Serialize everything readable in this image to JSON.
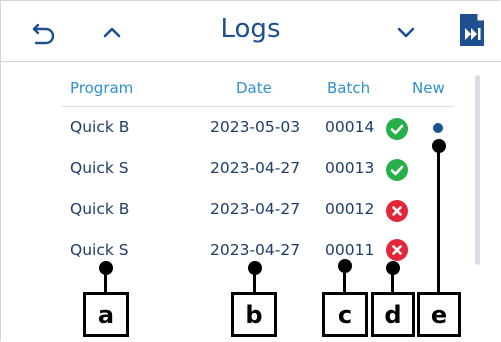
{
  "header": {
    "title": "Logs"
  },
  "columns": {
    "program": "Program",
    "date": "Date",
    "batch": "Batch",
    "new": "New"
  },
  "rows": [
    {
      "program": "Quick B",
      "date": "2023-05-03",
      "batch": "00014",
      "status": "success",
      "new": true
    },
    {
      "program": "Quick S",
      "date": "2023-04-27",
      "batch": "00013",
      "status": "success",
      "new": false
    },
    {
      "program": "Quick B",
      "date": "2023-04-27",
      "batch": "00012",
      "status": "failure",
      "new": false
    },
    {
      "program": "Quick S",
      "date": "2023-04-27",
      "batch": "00011",
      "status": "failure",
      "new": false
    }
  ],
  "callouts": [
    "a",
    "b",
    "c",
    "d",
    "e"
  ],
  "icons": {
    "back": "back-arrow-icon",
    "up": "chevron-up-icon",
    "down": "chevron-down-icon",
    "export": "export-icon",
    "success": "check-circle-icon",
    "failure": "x-circle-icon",
    "new": "new-dot-icon"
  },
  "colors": {
    "accent": "#1e4f8f",
    "header_text": "#2f8fcf",
    "success": "#27b04a",
    "failure": "#e3263a",
    "new_dot": "#1e4f8f"
  }
}
